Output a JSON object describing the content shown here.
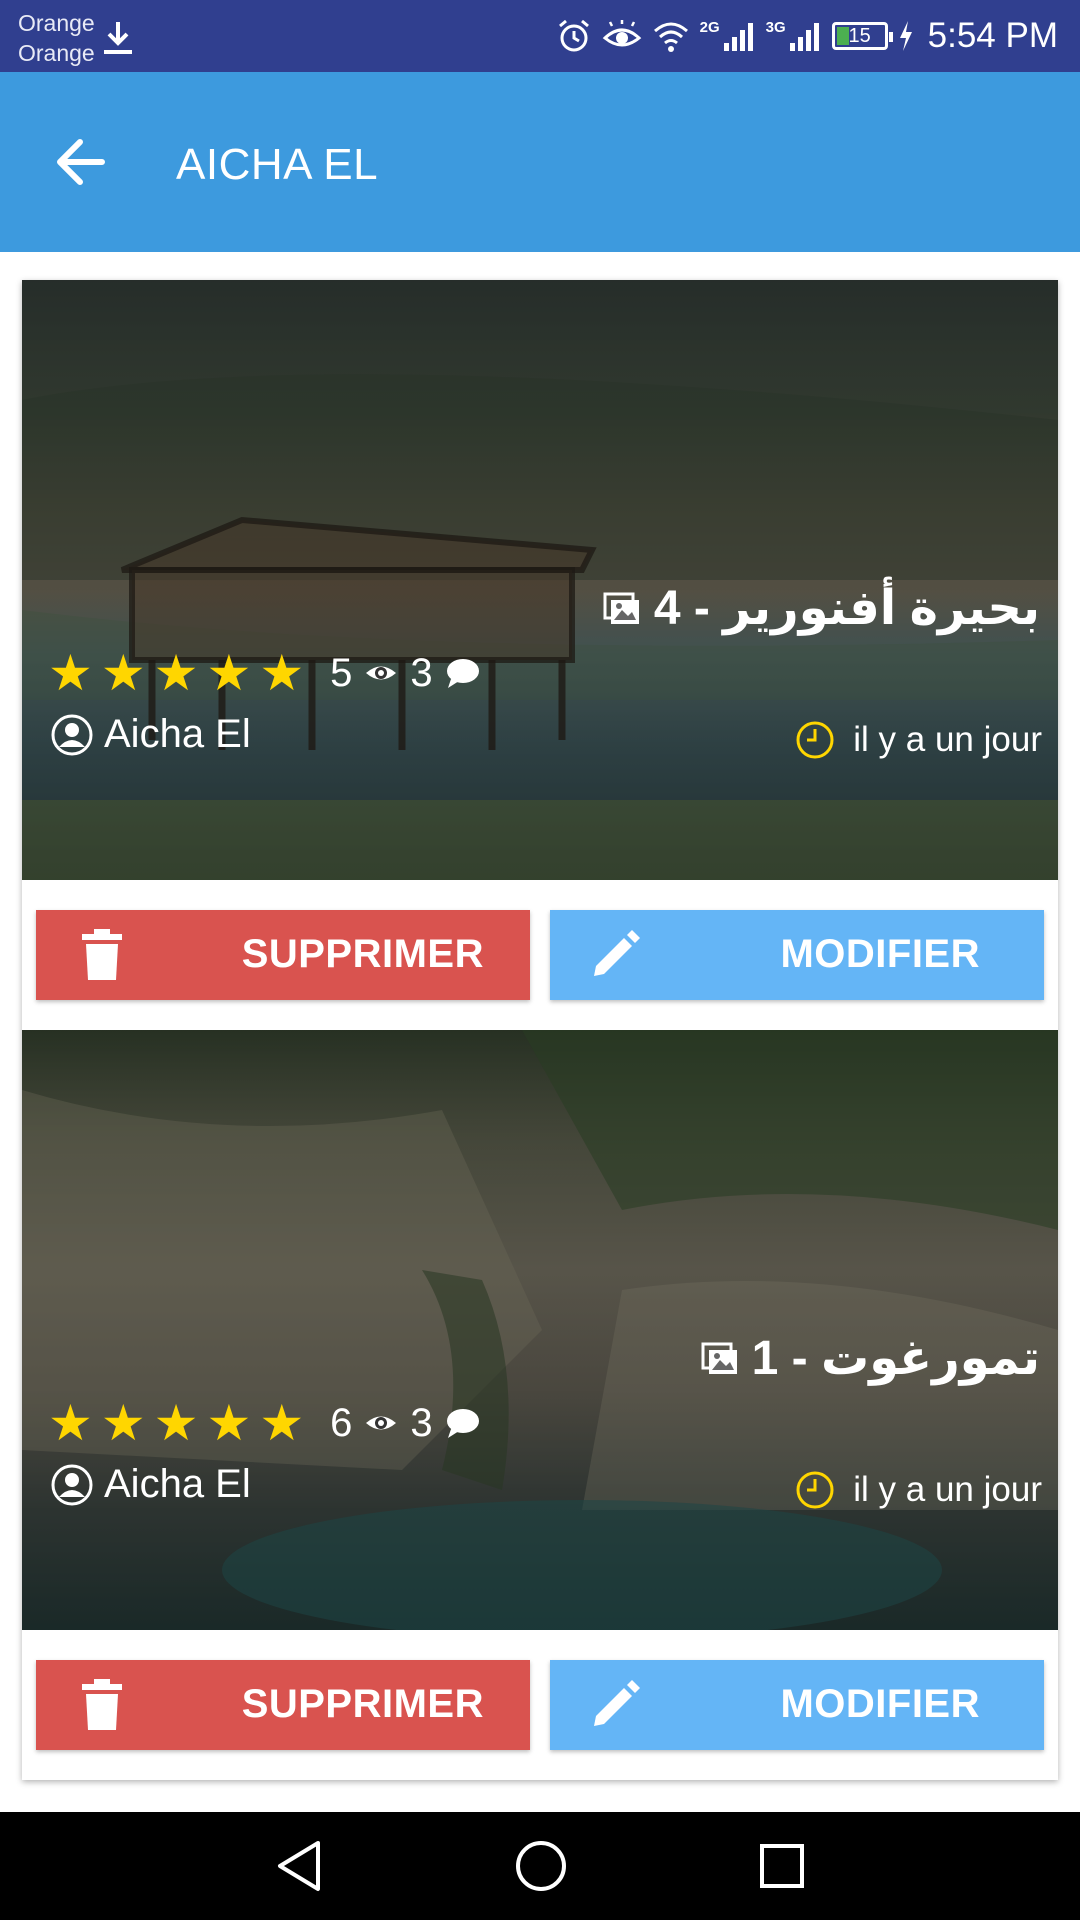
{
  "status_bar": {
    "carrier_1": "Orange",
    "carrier_2": "Orange",
    "net_2g": "2G",
    "net_3g": "3G",
    "battery": "15",
    "time": "5:54 PM"
  },
  "app_bar": {
    "title": "AICHA EL",
    "back_icon": "arrow-back-icon",
    "color": "#3d9ade"
  },
  "posts": [
    {
      "title": "بحيرة أفنورير - 4",
      "rating": 5,
      "views": "5",
      "comments": "3",
      "author": "Aicha El",
      "time_ago": "il y a un jour",
      "delete_label": "SUPPRIMER",
      "edit_label": "MODIFIER"
    },
    {
      "title": "تمورغوت - 1",
      "rating": 5,
      "views": "6",
      "comments": "3",
      "author": "Aicha El",
      "time_ago": "il y a un jour",
      "delete_label": "SUPPRIMER",
      "edit_label": "MODIFIER"
    }
  ],
  "colors": {
    "delete": "#d9534f",
    "edit": "#64b5f6",
    "star": "#ffd600",
    "status_bar": "#303f8f"
  }
}
